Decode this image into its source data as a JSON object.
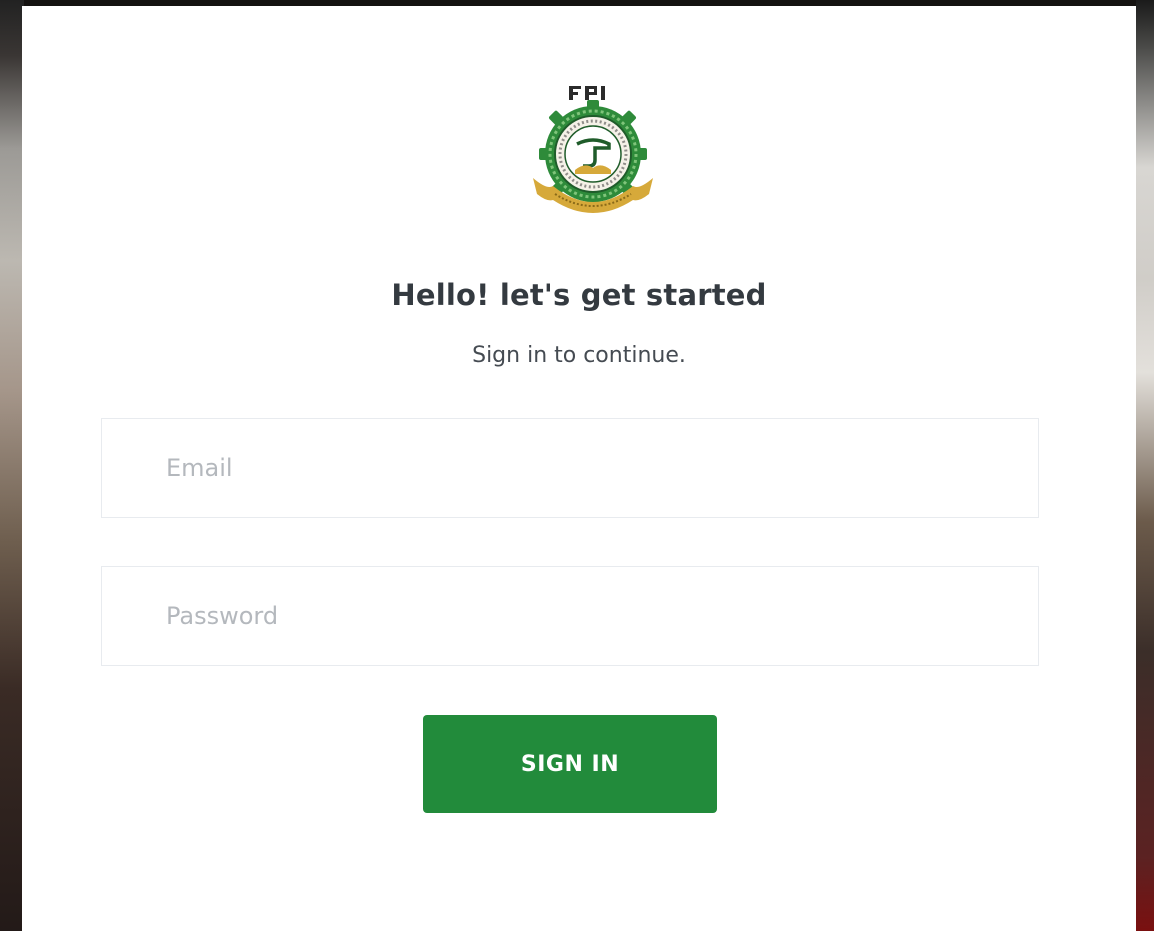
{
  "logo": {
    "name": "FPI institutional crest",
    "letters": "FPI",
    "colors": {
      "gear": "#2e8b3a",
      "ring": "#f5f1e8",
      "ribbon": "#d6a93a",
      "accent": "#1f5c2a"
    }
  },
  "login": {
    "title": "Hello! let's get started",
    "subtitle": "Sign in to continue.",
    "email_placeholder": "Email",
    "email_value": "",
    "password_placeholder": "Password",
    "password_value": "",
    "submit_label": "SIGN IN"
  },
  "theme": {
    "primary": "#228b3b",
    "card_background": "#ffffff",
    "title_color": "#343a40",
    "placeholder_color": "#b4b8bd",
    "input_border": "#e8ebef"
  }
}
